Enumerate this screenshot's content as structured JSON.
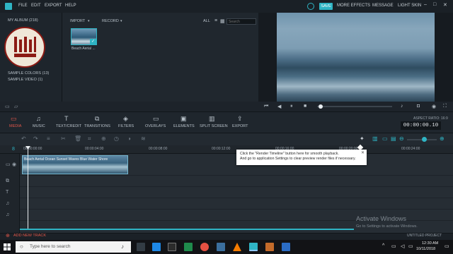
{
  "menu": {
    "file": "FILE",
    "edit": "EDIT",
    "export": "EXPORT",
    "help": "HELP"
  },
  "top_right": {
    "save": "SAVE",
    "more_effects": "MORE EFFECTS",
    "message": "MESSAGE",
    "light_skin": "LIGHT SKIN"
  },
  "album": {
    "items": [
      {
        "label": "MY ALBUM (218)"
      },
      {
        "label": "SAMPLE COLORS (13)"
      },
      {
        "label": "SAMPLE VIDEO (1)"
      }
    ]
  },
  "media": {
    "import_label": "IMPORT",
    "record_label": "RECORD",
    "filter_all": "ALL",
    "search_placeholder": "Search",
    "clip_name": "Beach Aerial ..."
  },
  "tabs": [
    {
      "label": "MEDIA",
      "icon": "folder-icon"
    },
    {
      "label": "MUSIC",
      "icon": "music-note-icon"
    },
    {
      "label": "TEXT/CREDIT",
      "icon": "text-icon"
    },
    {
      "label": "TRANSITIONS",
      "icon": "transitions-icon"
    },
    {
      "label": "FILTERS",
      "icon": "filters-icon"
    },
    {
      "label": "OVERLAYS",
      "icon": "overlays-icon"
    },
    {
      "label": "ELEMENTS",
      "icon": "elements-icon"
    },
    {
      "label": "SPLIT SCREEN",
      "icon": "split-screen-icon"
    },
    {
      "label": "EXPORT",
      "icon": "export-icon"
    }
  ],
  "aspect_ratio": "ASPECT RATIO: 16:9",
  "timecode": "00:00:00.10",
  "ruler": {
    "labels": [
      "00:00:00:00",
      "00:00:04:00",
      "00:00:08:00",
      "00:00:12:00",
      "00:00:16:00",
      "00:00:20:00",
      "00:00:24:00"
    ],
    "track_count": "8"
  },
  "timeline": {
    "clip_label": "Beach Aerial Ocean Sunset Waves Blue Water Shore"
  },
  "tooltip": {
    "line1": "Click the \"Render Timeline\" button here for smooth playback.",
    "line2": "And go to application Settings to clear preview render files if necessary."
  },
  "status": {
    "add_track": "ADD NEW TRACK",
    "project": "UNTITLED PROJECT"
  },
  "watermark": {
    "title": "Activate Windows",
    "subtitle": "Go to Settings to activate Windows."
  },
  "taskbar": {
    "search_placeholder": "Type here to search",
    "time": "12:30 AM",
    "date": "10/11/2018"
  },
  "colors": {
    "accent": "#2fb4c4",
    "active_tab": "#e2574a",
    "background": "#1b2127"
  }
}
